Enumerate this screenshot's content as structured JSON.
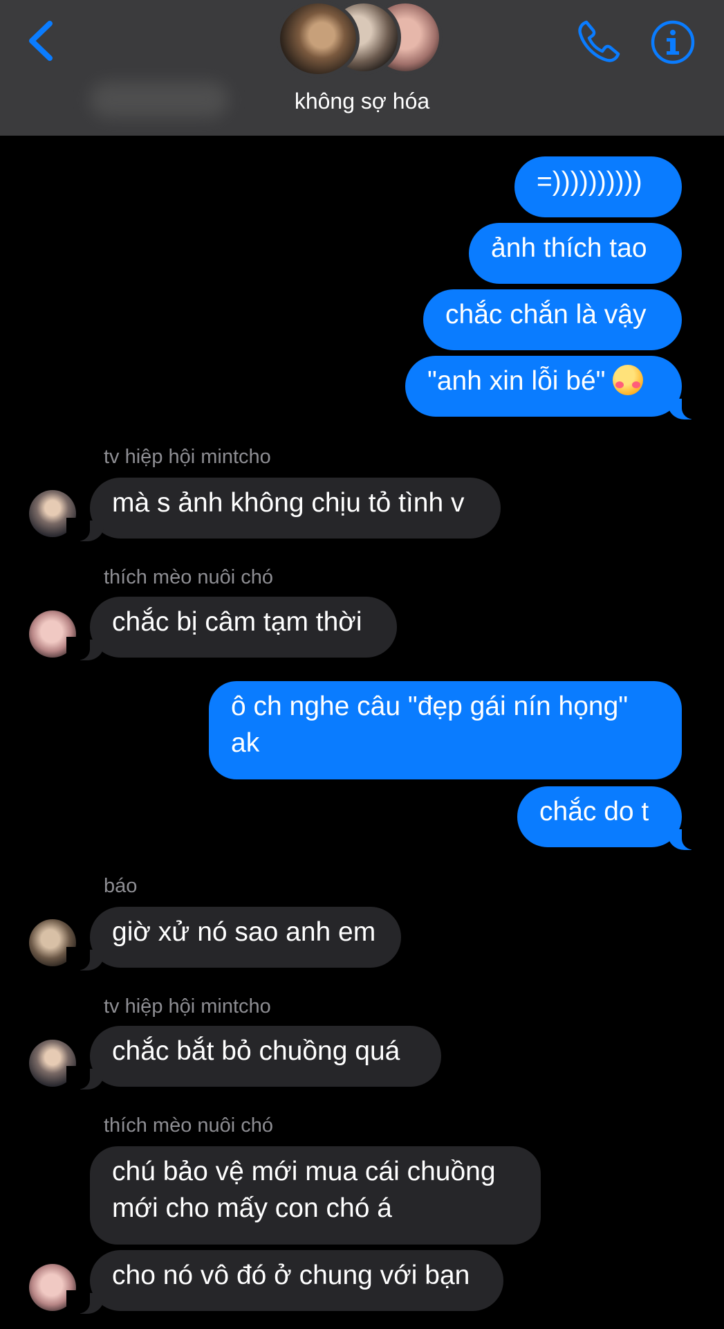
{
  "header": {
    "title": "không sợ hóa",
    "icons": {
      "back": "chevron-left-icon",
      "call": "phone-icon",
      "info": "info-icon"
    },
    "accent_color": "#0a7cff"
  },
  "messages": {
    "m1": "=))))))))))",
    "m2": "ảnh thích tao",
    "m3": "chắc chắn là vậy",
    "m4": "\"anh xin lỗi bé\"",
    "m4_emoji": "smiling-face-with-hearts-icon",
    "s1": "tv hiệp hội mintcho",
    "m5": "mà s ảnh không chịu tỏ tình v",
    "s2": "thích mèo nuôi chó",
    "m6": "chắc bị câm tạm thời",
    "m7": "ô ch nghe câu \"đẹp gái nín họng\" ak",
    "m8": "chắc do t",
    "s3": "báo",
    "m9": "giờ xử nó sao anh em",
    "s4": "tv hiệp hội mintcho",
    "m10": "chắc bắt bỏ chuồng quá",
    "s5": "thích mèo nuôi chó",
    "m11": "chú bảo vệ mới mua cái chuồng mới cho mấy con chó á",
    "m12": "cho nó vô đó ở chung với bạn"
  }
}
